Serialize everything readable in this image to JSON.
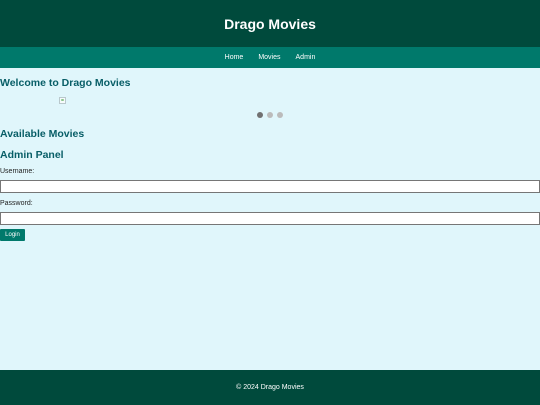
{
  "header": {
    "title": "Drago Movies"
  },
  "nav": {
    "items": [
      {
        "label": "Home"
      },
      {
        "label": "Movies"
      },
      {
        "label": "Admin"
      }
    ]
  },
  "welcome": {
    "heading": "Welcome to Drago Movies",
    "slides_total": 3,
    "active_slide": 1
  },
  "movies": {
    "heading": "Available Movies"
  },
  "admin": {
    "heading": "Admin Panel",
    "username_label": "Username:",
    "username_value": "",
    "password_label": "Password:",
    "password_value": "",
    "login_label": "Login"
  },
  "footer": {
    "text": "© 2024 Drago Movies"
  },
  "colors": {
    "header_bg": "#004a3c",
    "nav_bg": "#00796b",
    "page_bg": "#e0f6fb",
    "heading": "#085e67",
    "button_bg": "#00796b"
  }
}
